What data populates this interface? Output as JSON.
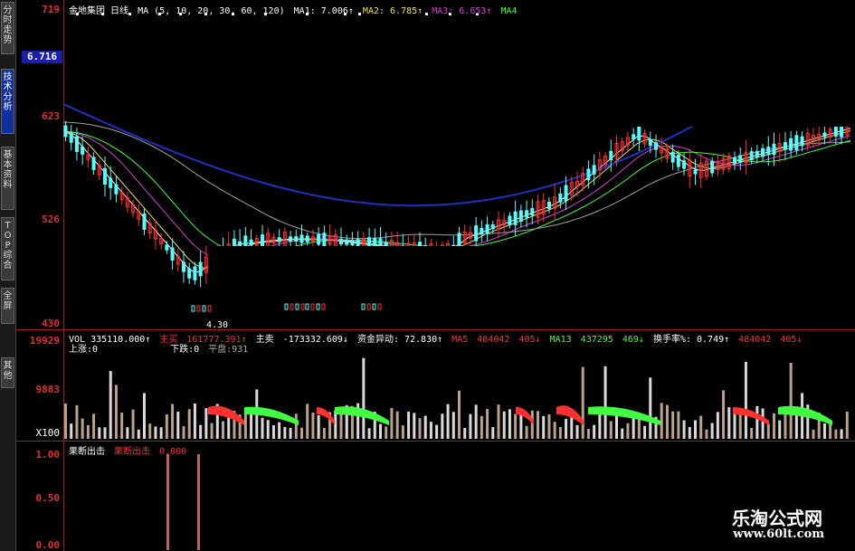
{
  "tabs": [
    {
      "label": "分时走势",
      "active": false
    },
    {
      "label": "技术分析",
      "active": true
    },
    {
      "label": "基本资料",
      "active": false
    },
    {
      "label": "TOP综合",
      "active": false
    },
    {
      "label": "全屏",
      "active": false
    },
    {
      "label": "其他",
      "active": false
    }
  ],
  "axis": {
    "main_ticks": [
      "719",
      "623",
      "526",
      "430"
    ],
    "current_price": "6.716",
    "vol_ticks": [
      "19929",
      "9883",
      "X100"
    ],
    "ind_ticks": [
      "1.00",
      "0.50",
      "0.00"
    ]
  },
  "main_header": {
    "stock": "金地集团 日线",
    "ma_params": "MA (5, 10, 20, 30, 60, 120)",
    "ma1": "MA1: 7.006↑",
    "ma2": "MA2: 6.785↑",
    "ma3": "MA3: 6.653↑",
    "ma4": "MA4"
  },
  "low_label": "4.30",
  "vol_header": {
    "vol": "VOL 335110.000↑",
    "zhumai": "主买",
    "zhumai_val": "161777.391↑",
    "zhumai2": "主卖",
    "zhumai2_val": "-173332.609↓",
    "zijin": "资金异动: 72.830↑",
    "ma5": "MA5",
    "ma5_val": "484042",
    "ma5_v2": "405↓",
    "ma13": "MA13",
    "ma13_val": "437295",
    "ma13_v2": "469↓",
    "huanshou": "换手率%: 0.749↑",
    "h_val": "484042",
    "h_v2": "405↓",
    "up": "上涨:0",
    "down": "下跌:0",
    "flat": "平盘:931"
  },
  "ind_header": {
    "name": "果断出击",
    "label": "果断出击",
    "value": "0.000"
  },
  "watermark": {
    "title": "乐淘公式网",
    "url": "www.60lt.com"
  },
  "colors": {
    "up": "#ff3030",
    "down": "#54ffff",
    "axis": "#9a1f1f",
    "ma1": "#ffffff",
    "ma2": "#f0e060",
    "ma3": "#d040d0",
    "ma4": "#40ff40",
    "ma60": "#a0a0a0",
    "ma120": "#2030c0"
  }
}
